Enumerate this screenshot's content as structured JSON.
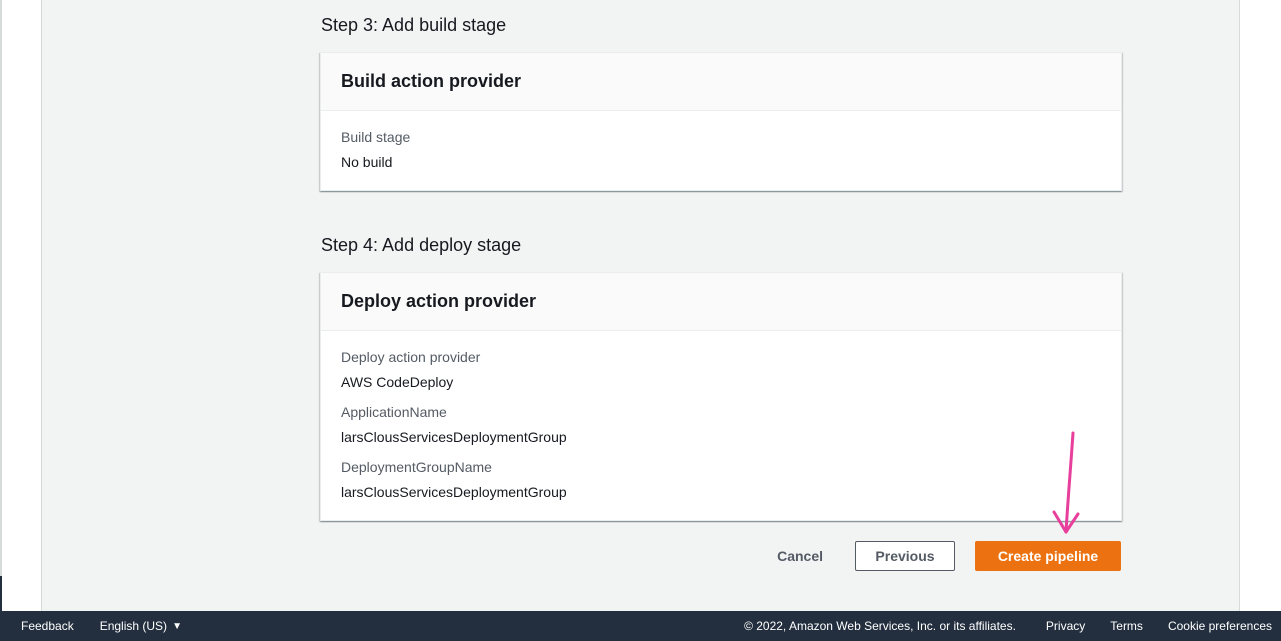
{
  "steps": [
    {
      "title": "Step 3: Add build stage",
      "card_title": "Build action provider",
      "fields": [
        {
          "label": "Build stage",
          "value": "No build"
        }
      ]
    },
    {
      "title": "Step 4: Add deploy stage",
      "card_title": "Deploy action provider",
      "fields": [
        {
          "label": "Deploy action provider",
          "value": "AWS CodeDeploy"
        },
        {
          "label": "ApplicationName",
          "value": "larsClousServicesDeploymentGroup"
        },
        {
          "label": "DeploymentGroupName",
          "value": "larsClousServicesDeploymentGroup"
        }
      ]
    }
  ],
  "actions": {
    "cancel_label": "Cancel",
    "previous_label": "Previous",
    "create_label": "Create pipeline"
  },
  "annotation": {
    "color": "#e83e9c"
  },
  "footer": {
    "feedback": "Feedback",
    "language": "English (US)",
    "copyright": "© 2022, Amazon Web Services, Inc. or its affiliates.",
    "privacy": "Privacy",
    "terms": "Terms",
    "cookie_preferences": "Cookie preferences"
  },
  "colors": {
    "primary_button": "#ec7211",
    "footer_bg": "#232f3e",
    "page_bg": "#f2f3f3"
  }
}
